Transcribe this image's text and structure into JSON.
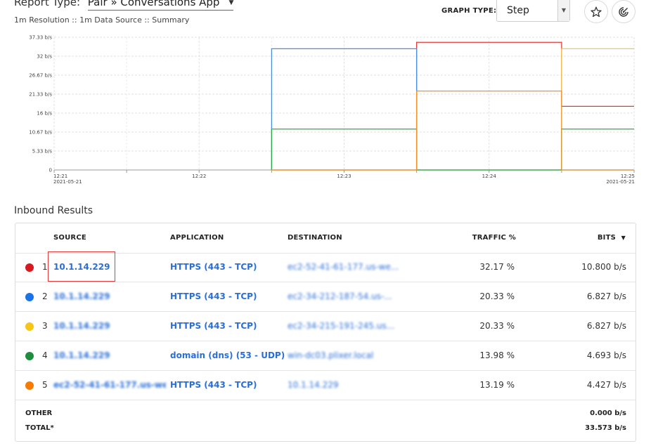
{
  "header": {
    "report_type_label": "Report Type:",
    "report_type_value": "Pair » Conversations App",
    "subtitle": "1m Resolution :: 1m Data Source :: Summary",
    "graph_type_label": "GRAPH TYPE:",
    "graph_type_value": "Step"
  },
  "chart_data": {
    "type": "line",
    "step": true,
    "y_ticks": [
      "37.33 b/s",
      "32 b/s",
      "26.67 b/s",
      "21.33 b/s",
      "16 b/s",
      "10.67 b/s",
      "5.33 b/s",
      "0"
    ],
    "x_ticks": [
      "12:21",
      "12:22",
      "12:23",
      "12:24",
      "12:25"
    ],
    "x_dates": [
      "2021-05-21",
      "2021-05-21"
    ],
    "ylim": [
      0,
      37.33
    ],
    "x": [
      "12:22.5",
      "12:23.5",
      "12:24.5",
      "12:25"
    ],
    "grid": true,
    "series": [
      {
        "color": "#e53935",
        "values": [
          0,
          35.9,
          17.9,
          17.9
        ]
      },
      {
        "color": "#4a90e2",
        "values": [
          34.1,
          0,
          0,
          0
        ]
      },
      {
        "color": "#f2c94c",
        "values": [
          0,
          0,
          34.1,
          34.1
        ]
      },
      {
        "color": "#2eaa4a",
        "values": [
          11.5,
          0,
          11.5,
          11.5
        ]
      },
      {
        "color": "#f2922b",
        "values": [
          0,
          22.2,
          0,
          0
        ]
      }
    ]
  },
  "results": {
    "title": "Inbound Results",
    "columns": {
      "source": "SOURCE",
      "application": "APPLICATION",
      "destination": "DESTINATION",
      "traffic": "TRAFFIC %",
      "bits": "BITS"
    },
    "rows": [
      {
        "color": "#d71920",
        "rank": "1",
        "source": "10.1.14.229",
        "application": "HTTPS (443 - TCP)",
        "destination": "ec2-52-41-61-177.us-we...",
        "traffic": "32.17 %",
        "bits": "10.800 b/s"
      },
      {
        "color": "#1a73e8",
        "rank": "2",
        "source": "10.1.14.229",
        "application": "HTTPS (443 - TCP)",
        "destination": "ec2-34-212-187-54.us-...",
        "traffic": "20.33 %",
        "bits": "6.827 b/s"
      },
      {
        "color": "#f5c518",
        "rank": "3",
        "source": "10.1.14.229",
        "application": "HTTPS (443 - TCP)",
        "destination": "ec2-34-215-191-245.us...",
        "traffic": "20.33 %",
        "bits": "6.827 b/s"
      },
      {
        "color": "#1e8e3e",
        "rank": "4",
        "source": "10.1.14.229",
        "application": "domain (dns) (53 - UDP)",
        "destination": "win-dc03.plixer.local",
        "traffic": "13.98 %",
        "bits": "4.693 b/s"
      },
      {
        "color": "#f57c00",
        "rank": "5",
        "source": "ec2-52-41-61-177.us-we...",
        "application": "HTTPS (443 - TCP)",
        "destination": "10.1.14.229",
        "traffic": "13.19 %",
        "bits": "4.427 b/s"
      }
    ],
    "other_label": "OTHER",
    "other_value": "0.000 b/s",
    "total_label": "TOTAL*",
    "total_value": "33.573 b/s"
  }
}
